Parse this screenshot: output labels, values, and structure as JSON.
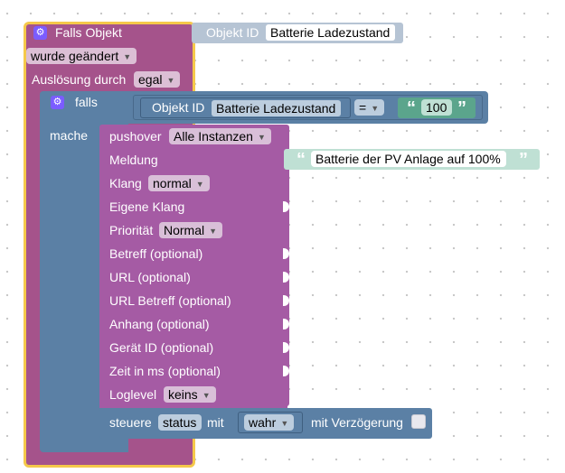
{
  "trigger": {
    "title": "Falls Objekt",
    "object_label": "Objekt ID",
    "object_value": "Batterie Ladezustand",
    "changed_value": "wurde geändert",
    "trigger_label": "Auslösung durch",
    "trigger_value": "egal"
  },
  "if_block": {
    "label": "falls",
    "do_label": "mache",
    "object_label": "Objekt ID",
    "object_value": "Batterie Ladezustand",
    "operator": "=",
    "compare_value": "100",
    "quote_open": "“",
    "quote_close": "”"
  },
  "pushover": {
    "title": "pushover",
    "instance": "Alle Instanzen",
    "fields": {
      "message": "Meldung",
      "sound": "Klang",
      "custom_sound": "Eigene Klang",
      "priority": "Priorität",
      "subject": "Betreff (optional)",
      "url": "URL (optional)",
      "url_title": "URL Betreff (optional)",
      "attachment": "Anhang (optional)",
      "device": "Gerät ID (optional)",
      "time": "Zeit in ms (optional)",
      "loglevel": "Loglevel"
    },
    "sound_value": "normal",
    "priority_value": "Normal",
    "loglevel_value": "keins",
    "message_text": "Batterie der PV Anlage auf 100%",
    "quote_open": "“",
    "quote_close": "”"
  },
  "control": {
    "label": "steuere",
    "state_value": "status",
    "with_label": "mit",
    "bool_value": "wahr",
    "delay_label": "mit Verzögerung"
  },
  "colors": {
    "event_block": "#a5538b",
    "logic_block": "#5b80a5",
    "pushover_block": "#a55ba4",
    "string_block": "#5ba58c",
    "object_block": "#b6c4d4",
    "selection_outline": "#f5c84a",
    "gear": "#7b5cff"
  }
}
